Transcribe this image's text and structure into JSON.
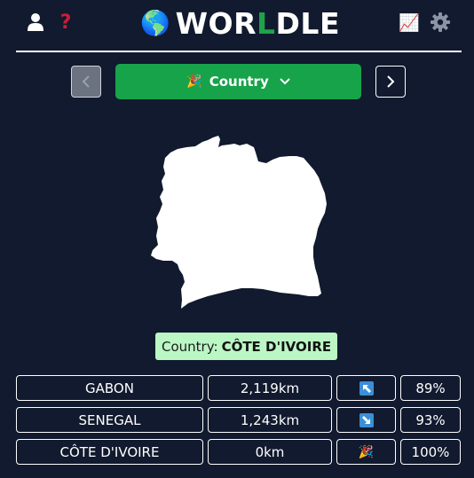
{
  "header": {
    "title_pre": "WOR",
    "title_l": "L",
    "title_post": "DLE",
    "globe_icon": "🌎",
    "icons": [
      "user-icon",
      "help-icon",
      "stats-icon",
      "settings-icon"
    ],
    "help_glyph": "?",
    "stats_glyph": "📈"
  },
  "nav": {
    "party_icon": "🎉",
    "game_label": "Country",
    "prev_glyph": "‹",
    "next_glyph": "›"
  },
  "answer": {
    "prefix": "Country:",
    "country": "CÔTE D'IVOIRE"
  },
  "guesses": [
    {
      "name": "GABON",
      "distance": "2,119km",
      "direction": "northwest",
      "direction_glyph": "↖",
      "proximity": "89%"
    },
    {
      "name": "SENEGAL",
      "distance": "1,243km",
      "direction": "southeast",
      "direction_glyph": "↘",
      "proximity": "93%"
    },
    {
      "name": "CÔTE D'IVOIRE",
      "distance": "0km",
      "direction": "correct",
      "direction_glyph": "🎉",
      "proximity": "100%"
    }
  ],
  "colors": {
    "background": "#111a2e",
    "accent_green": "#17a34a",
    "answer_bg": "#bbf7c5",
    "help_red": "#c81e3a",
    "arrow_blue": "#3b8fd6"
  }
}
